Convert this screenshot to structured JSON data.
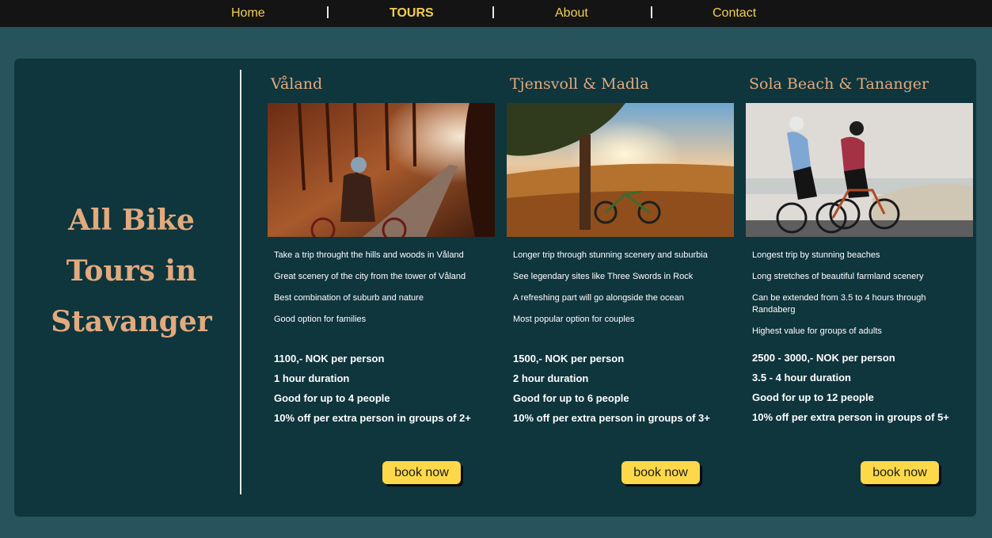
{
  "nav": {
    "items": [
      {
        "label": "Home",
        "active": false
      },
      {
        "label": "TOURS",
        "active": true
      },
      {
        "label": "About",
        "active": false
      },
      {
        "label": "Contact",
        "active": false
      }
    ],
    "separator": "|"
  },
  "colors": {
    "page_bg": "#26535c",
    "panel_bg": "#0f353d",
    "nav_bg": "#141414",
    "nav_text": "#f2cf52",
    "heading": "#e2aa7d",
    "button": "#fdd94a"
  },
  "sidebar": {
    "title_lines": [
      "All Bike",
      "Tours in",
      "Stavanger"
    ]
  },
  "tours": [
    {
      "title": "Våland",
      "image": "photo-cyclist-forest-road",
      "features": [
        "Take a trip throught the hills and woods in Våland",
        "Great scenery of the city from the tower of Våland",
        "Best combination of suburb and nature",
        "Good option for families"
      ],
      "price": "1100,- NOK per person",
      "duration": "1 hour duration",
      "capacity": "Good for up to 4 people",
      "discount": "10% off per extra person in groups of 2+",
      "button": "book now"
    },
    {
      "title": "Tjensvoll & Madla",
      "image": "photo-bike-under-tree-sunset",
      "features": [
        "Longer trip through stunning scenery and suburbia",
        "See legendary sites like Three Swords in Rock",
        "A refreshing part will go alongside the ocean",
        "Most popular option for couples"
      ],
      "price": "1500,- NOK per person",
      "duration": "2 hour duration",
      "capacity": "Good for up to 6 people",
      "discount": "10% off per extra person in groups of 3+",
      "button": "book now"
    },
    {
      "title": "Sola Beach & Tananger",
      "image": "photo-two-cyclists-beach",
      "features": [
        "Longest trip by stunning beaches",
        "Long stretches of beautiful farmland scenery",
        "Can be extended from 3.5 to 4 hours through Randaberg",
        "Highest value for groups of adults"
      ],
      "price": "2500 - 3000,- NOK per person",
      "duration": "3.5 - 4 hour duration",
      "capacity": "Good for up to 12 people",
      "discount": "10% off per extra person in groups of 5+",
      "button": "book now"
    }
  ]
}
